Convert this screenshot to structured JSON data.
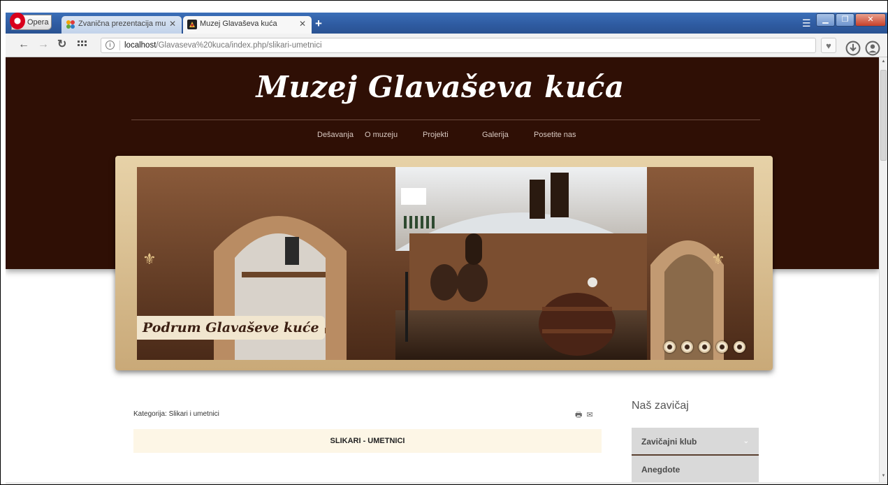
{
  "browser": {
    "opera_label": "Opera",
    "tabs": [
      {
        "title": "Zvanična prezentacija mu"
      },
      {
        "title": "Muzej Glavaševa kuća"
      }
    ],
    "close_glyph": "✕",
    "newtab_glyph": "+",
    "url_host": "localhost",
    "url_path": "/Glavaseva%20kuca/index.php/slikari-umetnici"
  },
  "site": {
    "title": "Muzej Glavaševa kuća",
    "nav": [
      "Dešavanja",
      "O muzeju",
      "Projekti",
      "Galerija",
      "Posetite nas"
    ],
    "slider": {
      "caption": "Podrum Glavaševe kuće",
      "slides": 5
    }
  },
  "article": {
    "category_label": "Kategorija: Slikari i umetnici",
    "heading": "SLIKARI - UMETNICI"
  },
  "sidebar": {
    "title": "Naš zavičaj",
    "items": [
      {
        "label": "Zavičajni klub"
      },
      {
        "label": "Anegdote"
      }
    ]
  },
  "colors": {
    "header_bg": "#2f0f05",
    "article_header_bg": "#fdf6e6",
    "sidebar_item_bg": "#d9d9d9"
  },
  "icons": [
    "opera-logo-icon",
    "back-icon",
    "forward-icon",
    "reload-icon",
    "speed-dial-icon",
    "site-info-icon",
    "heart-icon",
    "download-icon",
    "account-icon",
    "print-icon",
    "email-icon",
    "chevron-down-icon"
  ]
}
